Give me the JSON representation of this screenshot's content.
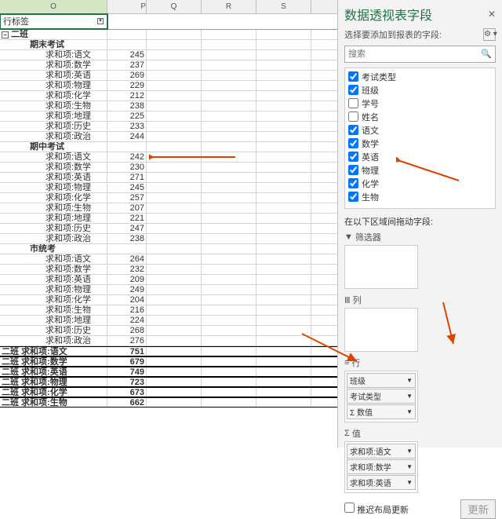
{
  "columns": {
    "o": "O",
    "p": "P",
    "q": "Q",
    "r": "R",
    "s": "S"
  },
  "namebox": "行标签",
  "tree": {
    "class_label": "二班",
    "groups": [
      {
        "name": "期末考试",
        "items": [
          {
            "label": "求和项:语文",
            "val": 245
          },
          {
            "label": "求和项:数学",
            "val": 237
          },
          {
            "label": "求和项:英语",
            "val": 269
          },
          {
            "label": "求和项:物理",
            "val": 229
          },
          {
            "label": "求和项:化学",
            "val": 212
          },
          {
            "label": "求和项:生物",
            "val": 238
          },
          {
            "label": "求和项:地理",
            "val": 225
          },
          {
            "label": "求和项:历史",
            "val": 233
          },
          {
            "label": "求和项:政治",
            "val": 244
          }
        ]
      },
      {
        "name": "期中考试",
        "items": [
          {
            "label": "求和项:语文",
            "val": 242
          },
          {
            "label": "求和项:数学",
            "val": 230
          },
          {
            "label": "求和项:英语",
            "val": 271
          },
          {
            "label": "求和项:物理",
            "val": 245
          },
          {
            "label": "求和项:化学",
            "val": 257
          },
          {
            "label": "求和项:生物",
            "val": 207
          },
          {
            "label": "求和项:地理",
            "val": 221
          },
          {
            "label": "求和项:历史",
            "val": 247
          },
          {
            "label": "求和项:政治",
            "val": 238
          }
        ]
      },
      {
        "name": "市统考",
        "items": [
          {
            "label": "求和项:语文",
            "val": 264
          },
          {
            "label": "求和项:数学",
            "val": 232
          },
          {
            "label": "求和项:英语",
            "val": 209
          },
          {
            "label": "求和项:物理",
            "val": 249
          },
          {
            "label": "求和项:化学",
            "val": 204
          },
          {
            "label": "求和项:生物",
            "val": 216
          },
          {
            "label": "求和项:地理",
            "val": 224
          },
          {
            "label": "求和项:历史",
            "val": 268
          },
          {
            "label": "求和项:政治",
            "val": 276
          }
        ]
      }
    ],
    "totals": [
      {
        "label": "二班 求和项:语文",
        "val": 751
      },
      {
        "label": "二班 求和项:数学",
        "val": 679
      },
      {
        "label": "二班 求和项:英语",
        "val": 749
      },
      {
        "label": "二班 求和项:物理",
        "val": 723
      },
      {
        "label": "二班 求和项:化学",
        "val": 673
      },
      {
        "label": "二班 求和项:生物",
        "val": 662
      }
    ]
  },
  "pane": {
    "title": "数据透视表字段",
    "subtitle": "选择要添加到报表的字段:",
    "search_placeholder": "搜索",
    "fields": [
      {
        "label": "考试类型",
        "checked": true
      },
      {
        "label": "班级",
        "checked": true
      },
      {
        "label": "学号",
        "checked": false
      },
      {
        "label": "姓名",
        "checked": false
      },
      {
        "label": "语文",
        "checked": true
      },
      {
        "label": "数学",
        "checked": true
      },
      {
        "label": "英语",
        "checked": true
      },
      {
        "label": "物理",
        "checked": true
      },
      {
        "label": "化学",
        "checked": true
      },
      {
        "label": "生物",
        "checked": true
      }
    ],
    "areas_label": "在以下区域间拖动字段:",
    "filter_title": "筛选器",
    "columns_title": "列",
    "rows_title": "行",
    "values_title": "值",
    "row_items": [
      "班级",
      "考试类型",
      "Σ 数值"
    ],
    "value_items": [
      "求和项:语文",
      "求和项:数学",
      "求和项:英语"
    ],
    "defer_label": "推迟布局更新",
    "update_btn": "更新"
  }
}
